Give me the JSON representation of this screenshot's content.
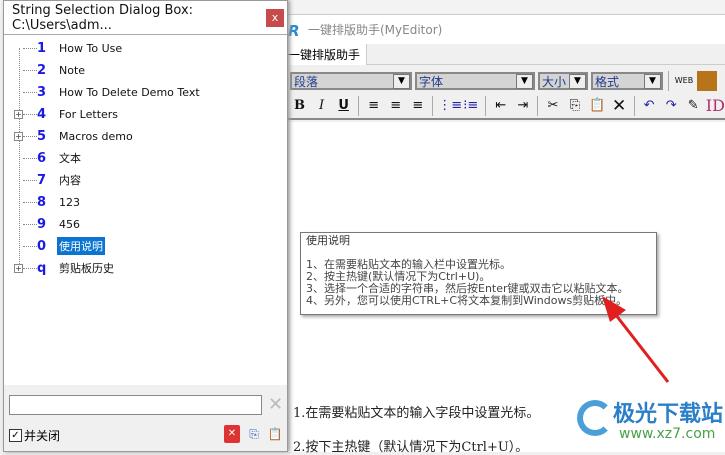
{
  "dialog": {
    "title": "String Selection Dialog Box: C:\\Users\\adm...",
    "close": "x",
    "items": [
      {
        "key": "1",
        "label": "How To Use",
        "expandable": false
      },
      {
        "key": "2",
        "label": "Note",
        "expandable": false
      },
      {
        "key": "3",
        "label": "How To Delete Demo Text",
        "expandable": false
      },
      {
        "key": "4",
        "label": "For Letters",
        "expandable": true
      },
      {
        "key": "5",
        "label": "Macros demo",
        "expandable": true
      },
      {
        "key": "6",
        "label": "文本",
        "expandable": false
      },
      {
        "key": "7",
        "label": "内容",
        "expandable": false
      },
      {
        "key": "8",
        "label": "123",
        "expandable": false
      },
      {
        "key": "9",
        "label": "456",
        "expandable": false
      },
      {
        "key": "0",
        "label": "使用说明",
        "expandable": false,
        "selected": true
      },
      {
        "key": "q",
        "label": "剪贴板历史",
        "expandable": true
      }
    ],
    "search_value": "",
    "close_checkbox_label": "并关闭",
    "close_checked": true
  },
  "editor": {
    "title": "一键排版助手(MyEditor)",
    "tab": "一键排版助手",
    "paragraph": "段落",
    "font": "字体",
    "size": "大小",
    "format": "格式",
    "tooltip": {
      "heading": "使用说明",
      "lines": [
        "1、在需要粘贴文本的输入栏中设置光标。",
        "2、按主热键(默认情况下为Ctrl+U)。",
        "3、选择一个合适的字符串，然后按Enter键或双击它以粘贴文本。",
        "4、另外，您可以使用CTRL+C将文本复制到Windows剪贴板中。"
      ]
    },
    "body": [
      "1.在需要粘贴文本的输入字段中设置光标。",
      "2.按下主热键（默认情况下为Ctrl+U）。"
    ]
  },
  "watermark": {
    "name": "极光下载站",
    "url": "www.xz7.com"
  }
}
